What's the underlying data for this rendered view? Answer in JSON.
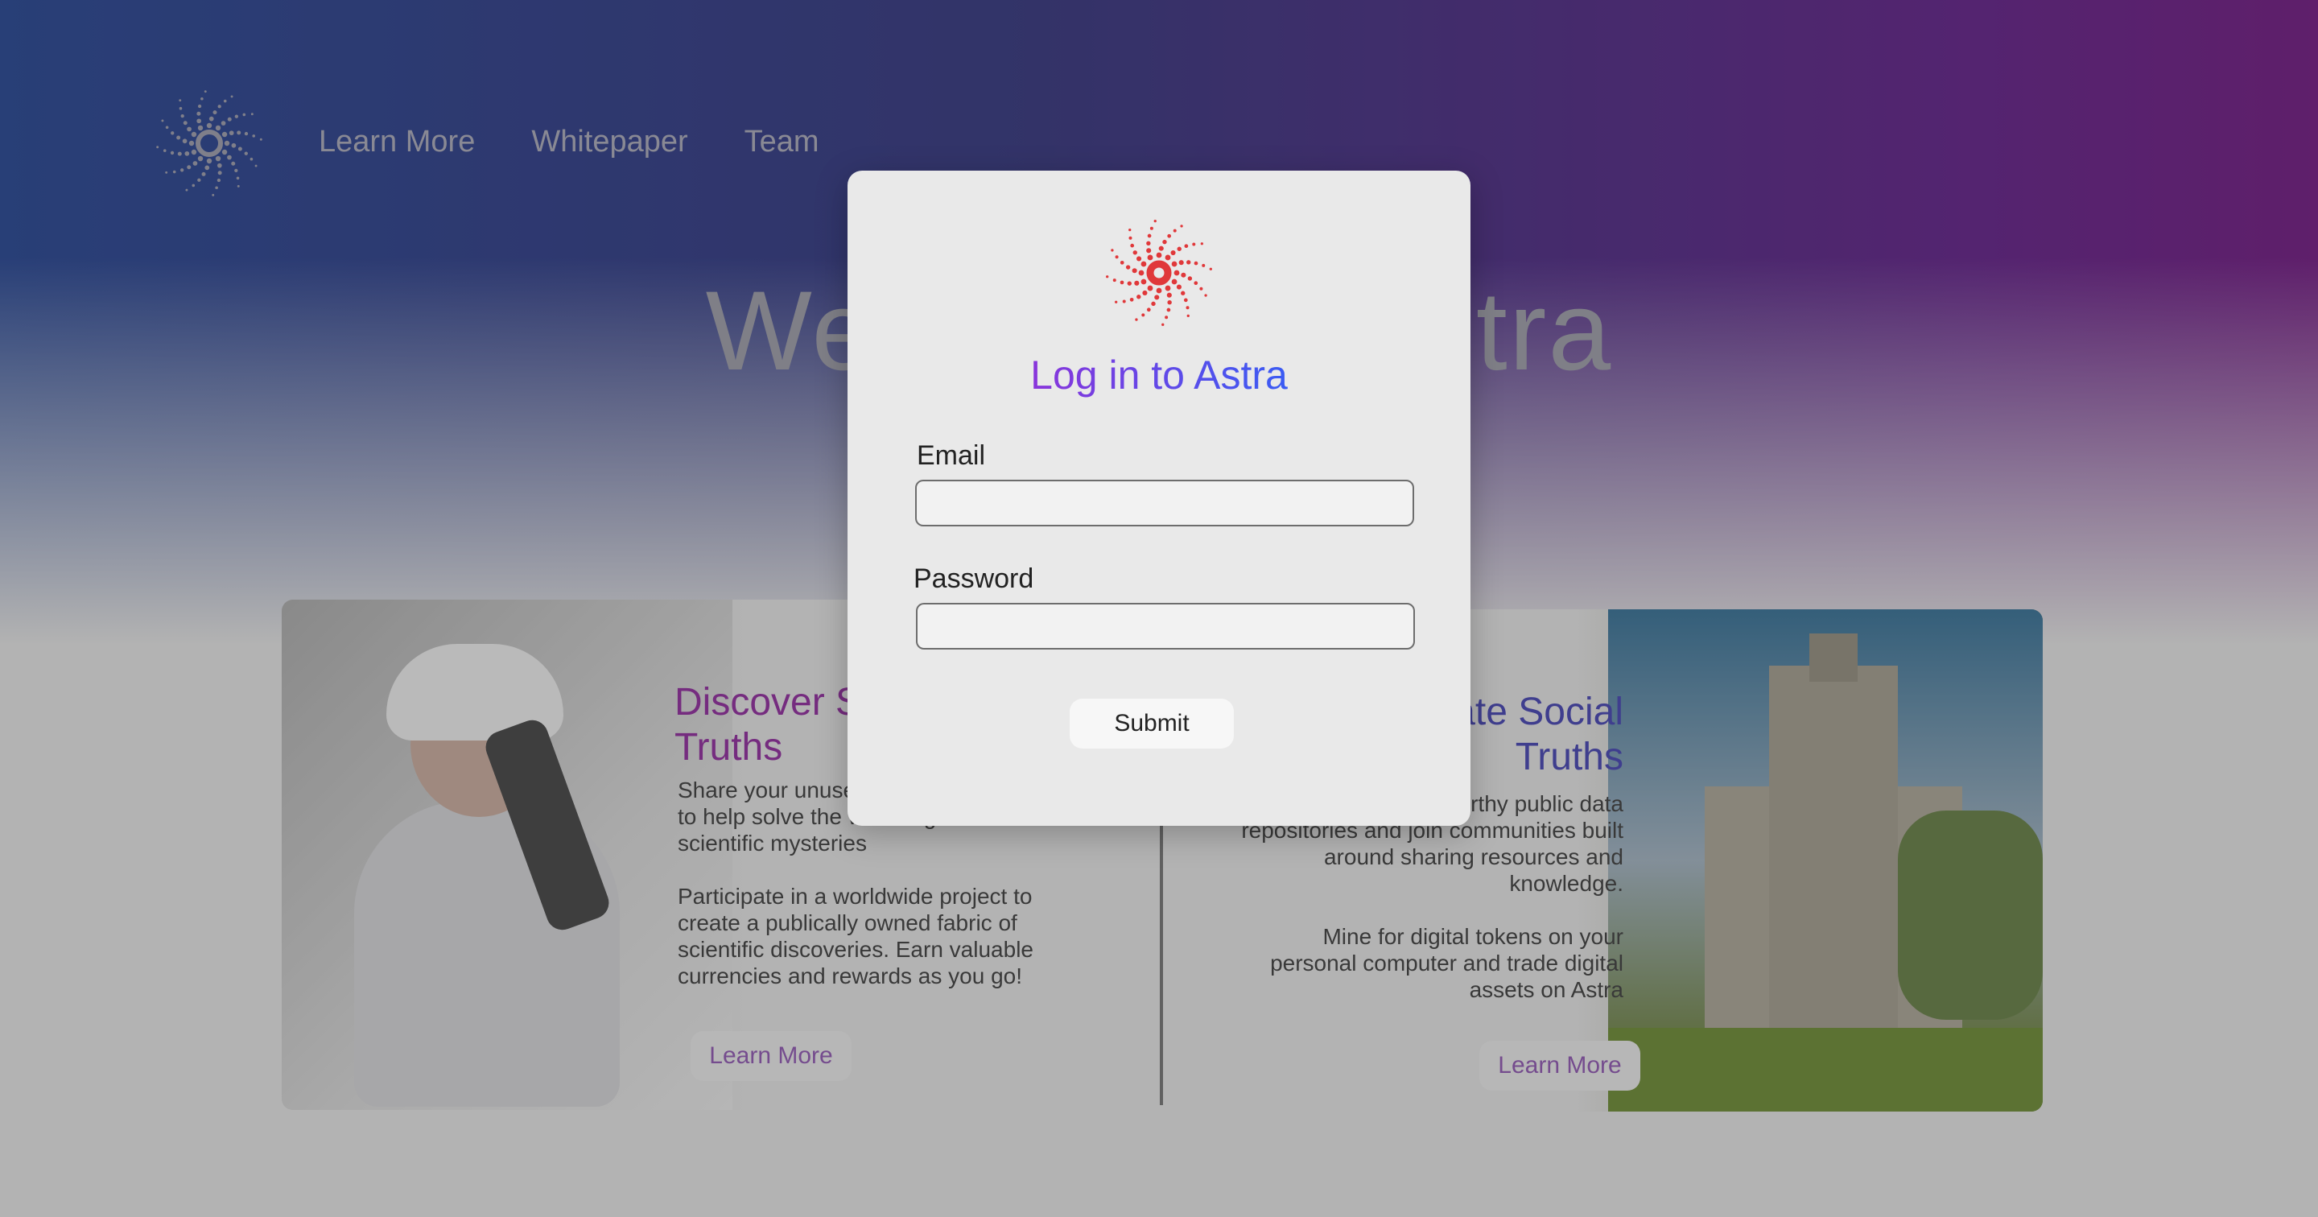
{
  "nav": {
    "links": [
      "Learn More",
      "Whitepaper",
      "Team"
    ]
  },
  "hero": {
    "title": "Welcome to Astra"
  },
  "cards": {
    "left": {
      "title_line1": "Discover Scientific",
      "title_line2": "Truths",
      "paragraph1": "Share your unused computing power to help solve the world's greatest scientific mysteries",
      "paragraph2": "Participate in a worldwide project to create a publically owned fabric of scientific discoveries. Earn valuable currencies and rewards as you go!",
      "button_label": "Learn More"
    },
    "right": {
      "title_line1": "Investigate Social",
      "title_line2": "Truths",
      "paragraph1": "Contribute to trustworthy public data repositories and join communities built around sharing resources and knowledge.",
      "paragraph2": "Mine for digital tokens on your personal computer and trade digital assets on Astra",
      "button_label": "Learn More"
    }
  },
  "modal": {
    "title": "Log in to Astra",
    "email_label": "Email",
    "email_value": "",
    "password_label": "Password",
    "password_value": "",
    "submit_label": "Submit"
  },
  "icons": {
    "logo": "sunburst-logo-icon",
    "modal_logo": "sunburst-logo-icon"
  },
  "colors": {
    "brand_accent": "#e0383a",
    "title_gradient_start": "#c319c9",
    "title_gradient_end": "#3b5bf3"
  }
}
